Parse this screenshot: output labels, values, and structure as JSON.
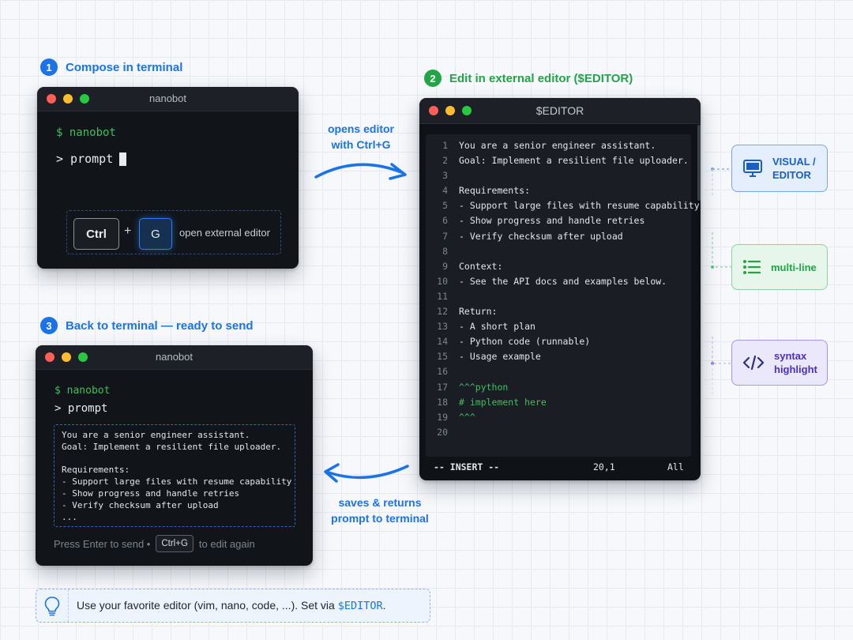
{
  "step1": {
    "number": "1",
    "title": "Compose in terminal"
  },
  "step2": {
    "number": "2",
    "title": "Edit in external editor ($EDITOR)"
  },
  "step3": {
    "number": "3",
    "title": "Back to terminal — ready to send"
  },
  "terminal1": {
    "title": "nanobot",
    "command": "$ nanobot",
    "prompt": "> prompt",
    "key_ctrl": "Ctrl",
    "plus": "+",
    "key_g": "G",
    "shortcut_desc": "open external editor"
  },
  "arrow_top_caption": {
    "line1": "opens editor",
    "line2": "with Ctrl+G"
  },
  "arrow_bottom_caption": {
    "line1": "saves & returns",
    "line2": "prompt to terminal"
  },
  "editor": {
    "title": "$EDITOR",
    "lines": [
      {
        "n": "1",
        "text": "You are a senior engineer assistant."
      },
      {
        "n": "2",
        "text": "Goal: Implement a resilient file uploader."
      },
      {
        "n": "3",
        "text": ""
      },
      {
        "n": "4",
        "text": "Requirements:"
      },
      {
        "n": "5",
        "text": "- Support large files with resume capability"
      },
      {
        "n": "6",
        "text": "- Show progress and handle retries"
      },
      {
        "n": "7",
        "text": "- Verify checksum after upload"
      },
      {
        "n": "8",
        "text": ""
      },
      {
        "n": "9",
        "text": "Context:"
      },
      {
        "n": "10",
        "text": "- See the API docs and examples below."
      },
      {
        "n": "11",
        "text": ""
      },
      {
        "n": "12",
        "text": "Return:"
      },
      {
        "n": "13",
        "text": "- A short plan"
      },
      {
        "n": "14",
        "text": "- Python code (runnable)"
      },
      {
        "n": "15",
        "text": "- Usage example"
      },
      {
        "n": "16",
        "text": ""
      },
      {
        "n": "17",
        "text": "^^^python"
      },
      {
        "n": "18",
        "text": "# implement here"
      },
      {
        "n": "19",
        "text": "^^^"
      },
      {
        "n": "20",
        "text": ""
      }
    ],
    "status_mode": "-- INSERT --",
    "status_pos": "20,1",
    "status_scroll": "All"
  },
  "features": {
    "visual": {
      "line1": "VISUAL /",
      "line2": "EDITOR",
      "icon": "monitor-icon"
    },
    "multiline": {
      "label": "multi-line",
      "icon": "list-icon"
    },
    "syntax": {
      "line1": "syntax",
      "line2": "highlight",
      "icon": "code-icon"
    }
  },
  "terminal3": {
    "title": "nanobot",
    "command": "$ nanobot",
    "prompt": "> prompt",
    "lines": [
      "You are a senior engineer assistant.",
      "Goal: Implement a resilient file uploader.",
      "",
      "Requirements:",
      "- Support large files with resume capability",
      "- Show progress and handle retries",
      "- Verify checksum after upload",
      "..."
    ],
    "footer_pre": "Press Enter to send •",
    "footer_key": "Ctrl+G",
    "footer_post": "to edit again"
  },
  "tip": {
    "text_pre": "Use your favorite editor (vim, nano, code, ...). Set via ",
    "text_var": "$EDITOR",
    "text_post": ".",
    "icon": "lightbulb-icon"
  },
  "colors": {
    "blue": "#1a73e8",
    "green": "#22a447",
    "purple": "#5b3fd1"
  }
}
